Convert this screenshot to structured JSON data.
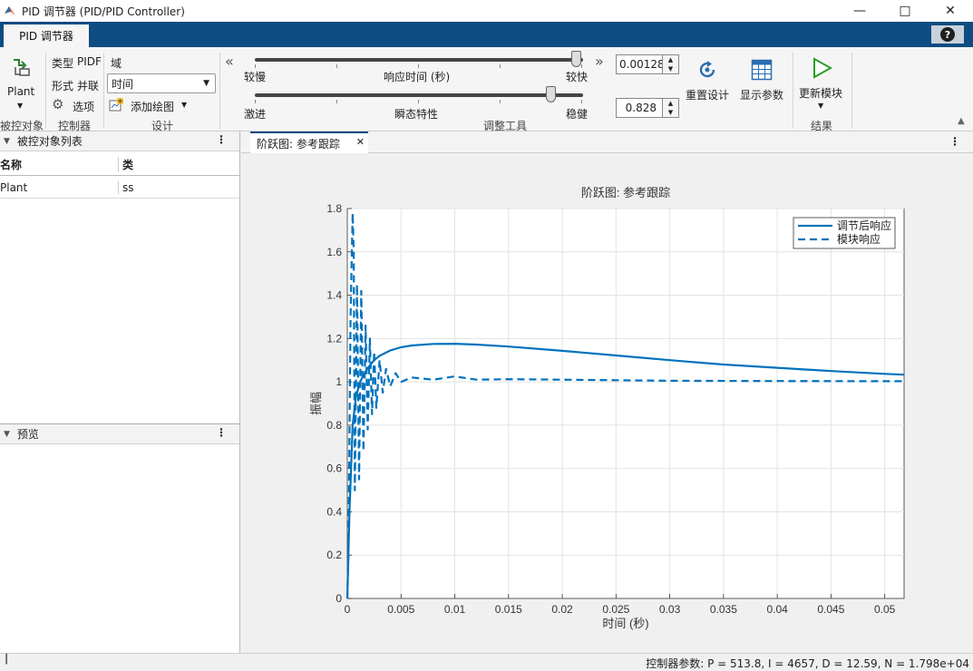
{
  "window": {
    "title": "PID 调节器 (PID/PID Controller)"
  },
  "tabs": {
    "main": "PID 调节器",
    "help": "?"
  },
  "toolstrip": {
    "plant_label": "Plant",
    "plant_group": "被控对象",
    "type_label": "类型",
    "type_value": "PIDF",
    "form_label": "形式",
    "form_value": "并联",
    "options_label": "选项",
    "controller_group": "控制器",
    "domain_label": "域",
    "domain_value": "时间",
    "add_plot_label": "添加绘图",
    "design_group": "设计",
    "slower_label": "较慢",
    "faster_label": "较快",
    "response_time_label": "响应时间 (秒)",
    "aggressive_label": "激进",
    "robust_label": "稳健",
    "transient_label": "瞬态特性",
    "tuning_group": "调整工具",
    "response_time_value": "0.00128",
    "transient_value": "0.828",
    "reset_label": "重置设计",
    "show_params_label": "显示参数",
    "update_block_label": "更新模块",
    "results_group": "结果"
  },
  "left_panel": {
    "plant_list_title": "被控对象列表",
    "columns": [
      "名称",
      "类"
    ],
    "rows": [
      [
        "Plant",
        "ss"
      ]
    ],
    "preview_title": "预览"
  },
  "doc_tab": {
    "label": "阶跃图: 参考跟踪"
  },
  "chart_data": {
    "type": "line",
    "title": "阶跃图: 参考跟踪",
    "xlabel": "时间 (秒)",
    "ylabel": "振幅",
    "xlim": [
      0,
      0.0518
    ],
    "ylim": [
      0,
      1.8
    ],
    "xticks": [
      0,
      0.005,
      0.01,
      0.015,
      0.02,
      0.025,
      0.03,
      0.035,
      0.04,
      0.045,
      0.05
    ],
    "xtick_labels": [
      "0",
      "0.005",
      "0.01",
      "0.015",
      "0.02",
      "0.025",
      "0.03",
      "0.035",
      "0.04",
      "0.045",
      "0.05"
    ],
    "yticks": [
      0,
      0.2,
      0.4,
      0.6,
      0.8,
      1,
      1.2,
      1.4,
      1.6,
      1.8
    ],
    "ytick_labels": [
      "0",
      "0.2",
      "0.4",
      "0.6",
      "0.8",
      "1",
      "1.2",
      "1.4",
      "1.6",
      "1.8"
    ],
    "grid": true,
    "legend_position": "top-right",
    "series": [
      {
        "name": "调节后响应",
        "style": "solid",
        "color": "#0072bd",
        "x": [
          0,
          0.0002,
          0.0005,
          0.0008,
          0.0012,
          0.0016,
          0.002,
          0.0025,
          0.003,
          0.004,
          0.005,
          0.006,
          0.008,
          0.01,
          0.012,
          0.015,
          0.02,
          0.025,
          0.03,
          0.035,
          0.04,
          0.045,
          0.05,
          0.0518
        ],
        "y": [
          0,
          0.4,
          0.8,
          0.93,
          1.0,
          1.04,
          1.07,
          1.1,
          1.12,
          1.145,
          1.16,
          1.168,
          1.175,
          1.176,
          1.172,
          1.163,
          1.143,
          1.122,
          1.1,
          1.08,
          1.065,
          1.05,
          1.037,
          1.033
        ]
      },
      {
        "name": "模块响应",
        "style": "dashed",
        "color": "#0072bd",
        "x": [
          0,
          0.0001,
          0.0003,
          0.0005,
          0.0006,
          0.0007,
          0.0009,
          0.0011,
          0.0013,
          0.0015,
          0.0017,
          0.0019,
          0.0021,
          0.0023,
          0.0025,
          0.0027,
          0.003,
          0.0033,
          0.0036,
          0.004,
          0.0045,
          0.005,
          0.006,
          0.008,
          0.01,
          0.012,
          0.015,
          0.02,
          0.03,
          0.04,
          0.05,
          0.0518
        ],
        "y": [
          0,
          0.2,
          1.3,
          1.78,
          1.6,
          0.5,
          1.45,
          0.55,
          1.42,
          0.68,
          1.26,
          0.78,
          1.2,
          0.85,
          1.14,
          0.88,
          1.1,
          0.95,
          1.06,
          0.98,
          1.04,
          1.0,
          1.02,
          1.01,
          1.025,
          1.01,
          1.012,
          1.01,
          1.005,
          1.004,
          1.003,
          1.003
        ]
      }
    ]
  },
  "status": {
    "text": "控制器参数: P = 513.8, I = 4657, D = 12.59, N = 1.798e+04"
  }
}
